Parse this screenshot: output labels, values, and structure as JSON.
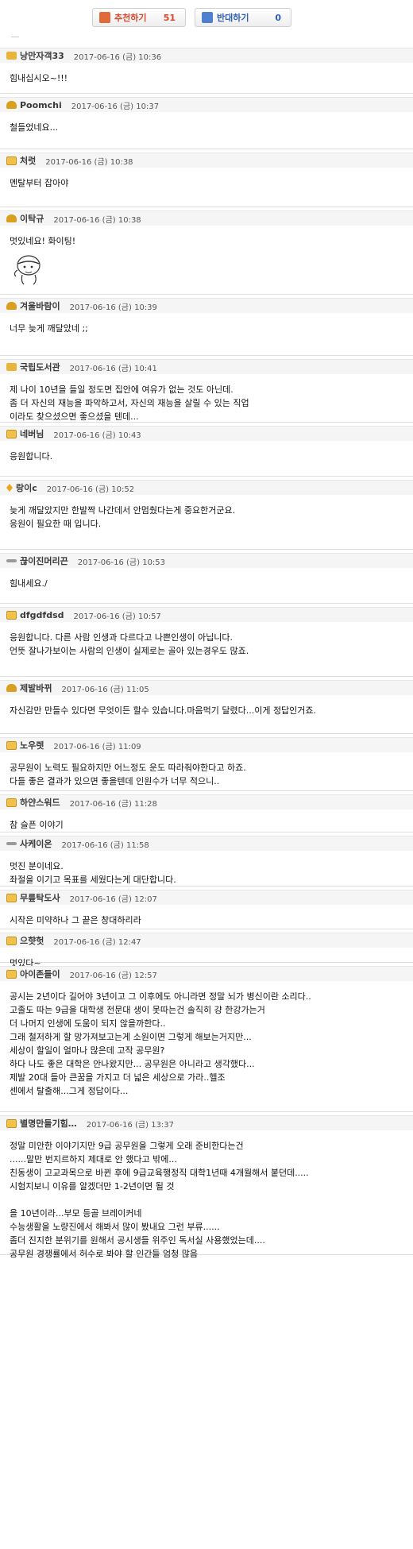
{
  "vote": {
    "recommend_label": "추천하기",
    "recommend_count": "51",
    "oppose_label": "반대하기",
    "oppose_count": "0"
  },
  "comments": [
    {
      "nick": "낭만자객33",
      "date": "2017-06-16 (금) 10:36",
      "lines": [
        "힘내십시오~!!!"
      ]
    },
    {
      "nick": "Poomchi",
      "date": "2017-06-16 (금) 10:37",
      "lines": [
        "철들었네요..."
      ]
    },
    {
      "nick": "처럿",
      "date": "2017-06-16 (금) 10:38",
      "lines": [
        "멘탈부터 잡아야"
      ]
    },
    {
      "nick": "이탁규",
      "date": "2017-06-16 (금) 10:38",
      "lines": [
        "멋있네요! 화이팅!"
      ]
    },
    {
      "nick": "겨울바람이",
      "date": "2017-06-16 (금) 10:39",
      "lines": [
        "너무 늦게 깨달았네 ;;"
      ]
    },
    {
      "nick": "국립도서관",
      "date": "2017-06-16 (금) 10:41",
      "lines": [
        "제 나이 10년을 들일 정도면 집안에 여유가 없는 것도 아닌데.",
        "좀 더 자신의 재능을 파악하고서, 자신의 재능을 살릴 수 있는 직업",
        "이라도 찾으셨으면 좋으셨을 텐데..."
      ]
    },
    {
      "nick": "네버님",
      "date": "2017-06-16 (금) 10:43",
      "lines": [
        "응원합니다."
      ]
    },
    {
      "nick": "랑이c",
      "date": "2017-06-16 (금) 10:52",
      "lines": [
        "늦게 깨달았지만 한발짝 나간데서 안멈췄다는게 중요한거군요.",
        "응원이 필요한 때 입니다."
      ]
    },
    {
      "nick": "끊이진머리끈",
      "date": "2017-06-16 (금) 10:53",
      "lines": [
        "힘내세요./"
      ]
    },
    {
      "nick": "dfgdfdsd",
      "date": "2017-06-16 (금) 10:57",
      "lines": [
        "응원합니다. 다른 사람 인생과 다르다고 나쁜인생이 아닙니다.",
        "언뜻 잘나가보이는 사람의 인생이 실제로는 골아 있는경우도 많죠."
      ]
    },
    {
      "nick": "제발바뀌",
      "date": "2017-06-16 (금) 11:05",
      "lines": [
        "자신감만 만들수 있다면 무엇이든 할수 있습니다.마음먹기 달렸다...이게 정답인거죠."
      ]
    },
    {
      "nick": "노우렛",
      "date": "2017-06-16 (금) 11:09",
      "lines": [
        "공무원이 노력도 필요하지만 어느정도 운도 따라줘야한다고 하죠.",
        "다들 좋은 결과가 있으면 좋을텐데 인원수가 너무 적으니.."
      ]
    },
    {
      "nick": "하얀스워드",
      "date": "2017-06-16 (금) 11:28",
      "lines": [
        "참 슬픈 이야기"
      ]
    },
    {
      "nick": "사케이온",
      "date": "2017-06-16 (금) 11:58",
      "lines": [
        "멋진 분이네요.",
        "좌절을 이기고 목표를 세웠다는게 대단합니다."
      ]
    },
    {
      "nick": "무릎탁도사",
      "date": "2017-06-16 (금) 12:07",
      "lines": [
        "시작은 미약하나 그 끝은 창대하리라"
      ]
    },
    {
      "nick": "으햣헛",
      "date": "2017-06-16 (금) 12:47",
      "lines": [
        "멋있다~"
      ]
    },
    {
      "nick": "아이존들이",
      "date": "2017-06-16 (금) 12:57",
      "lines": [
        "공시는 2년이다 길어야 3년이고 그 이후에도 아니라면 정말 뇌가 병신이란 소리다..",
        "고졸도 따는 9급을 대학생 전문대 생이 못따는건 솔직히 걍 한강가는거",
        "더 나머지 인생에 도움이 되지 않을까한다..",
        "그래 철저하게 할 망가져보고는게 소원이면 그렇게 해보는거지만...",
        "세상이 할일이 얼마나 많은데 고작 공무원?",
        "하다 나도 좋은 대학은 안나왔지만... 공무원은 아니라고 생각했다...",
        "제발 20대 들아 큰꿈을 가지고 더 넓은 세상으로 가라..헬조",
        "센에서 탈출해...그게 정답이다..."
      ]
    },
    {
      "nick": "별명만들기힘…",
      "date": "2017-06-16 (금) 13:37",
      "lines": [
        "정말 미안한 이야기지만 9급 공무원을 그렇게 오래 준비한다는건",
        "......말만 번지르하지 제대로 안 했다고 밖에...",
        "친동생이 고교과목으로 바뀐 후에 9급교육행정직 대학1년때 4개월해서 붙던데.....",
        "시험지보니 이유를 알겠더만 1-2년이면 될 것",
        "",
        "을 10년이라...부모 등골 브레이커네",
        "수능생활을 노량진에서 해봐서 많이 봤내요 그런 부류......",
        "좀더 진지한 분위기를 원해서 공시생들 위주인 독서실 사용했었는데....",
        "공무원 경쟁률에서 허수로 봐야 할 인간들 엄청 많음"
      ]
    }
  ]
}
